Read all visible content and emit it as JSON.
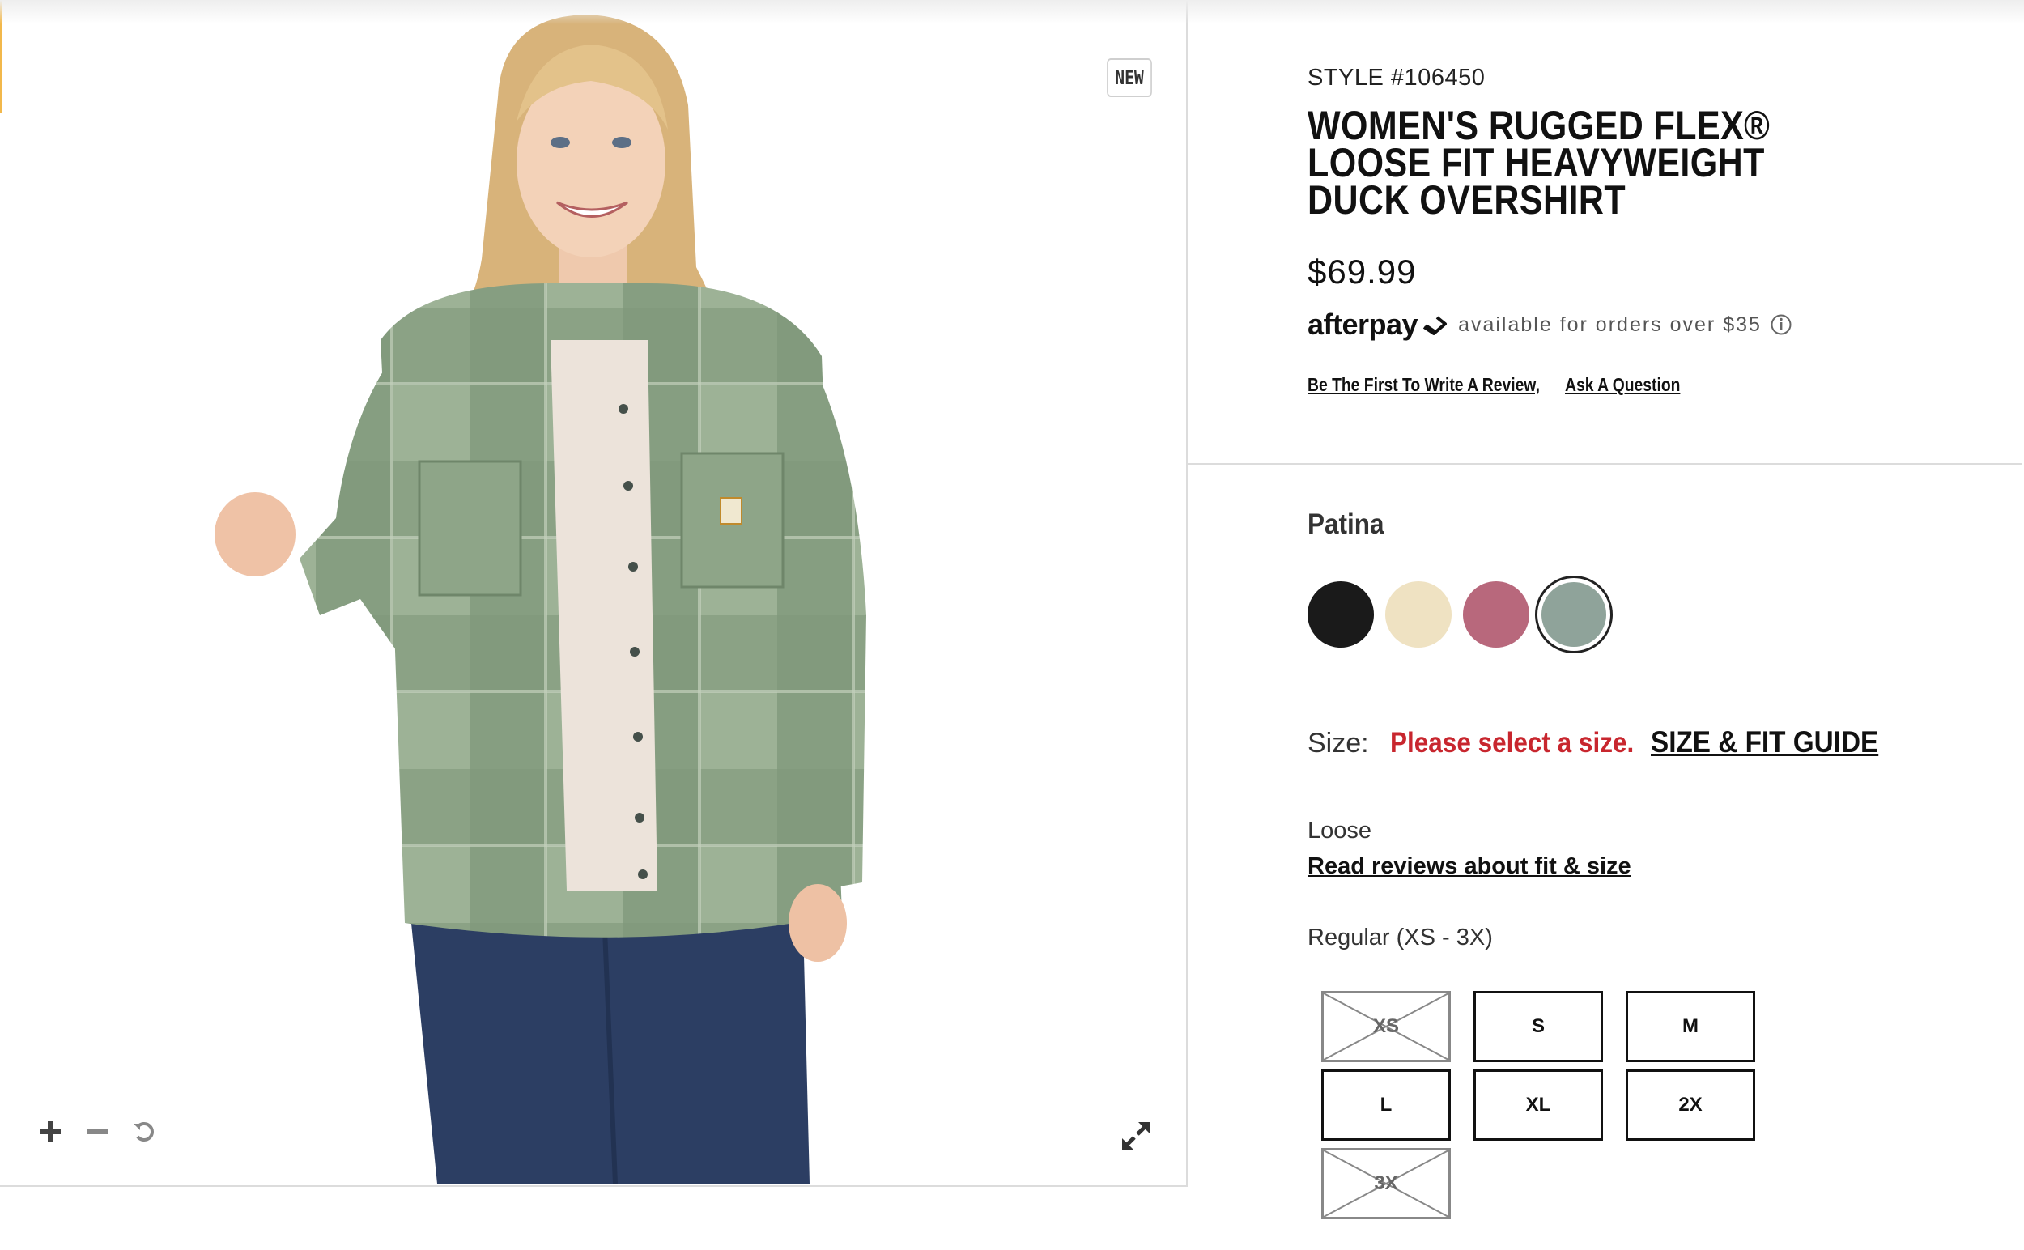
{
  "gallery": {
    "badge": "NEW",
    "image_alt": "Woman wearing a green plaid overshirt over a light t-shirt and jeans",
    "controls": [
      "zoom-in",
      "zoom-out",
      "reset"
    ]
  },
  "product": {
    "style_number": "STYLE #106450",
    "title": "WOMEN'S RUGGED FLEX® LOOSE FIT HEAVYWEIGHT DUCK OVERSHIRT",
    "price": "$69.99",
    "afterpay": {
      "logo": "afterpay",
      "text": "available for orders over $35"
    },
    "links": {
      "review": "Be The First To Write A Review,",
      "question": "Ask A Question"
    }
  },
  "color": {
    "selected_name": "Patina",
    "swatches": [
      {
        "name": "black",
        "hex": "#1a1a1a",
        "selected": false
      },
      {
        "name": "cream",
        "hex": "#efe2c2",
        "selected": false
      },
      {
        "name": "rose",
        "hex": "#b8687c",
        "selected": false
      },
      {
        "name": "patina",
        "hex": "#8fa39a",
        "selected": true
      }
    ]
  },
  "size": {
    "label": "Size:",
    "error": "Please select a size.",
    "guide_link": "SIZE & FIT GUIDE",
    "fit_label": "Loose",
    "fit_link": "Read reviews about fit & size",
    "range_label": "Regular (XS - 3X)",
    "options": [
      {
        "label": "XS",
        "available": false
      },
      {
        "label": "S",
        "available": true
      },
      {
        "label": "M",
        "available": true
      },
      {
        "label": "L",
        "available": true
      },
      {
        "label": "XL",
        "available": true
      },
      {
        "label": "2X",
        "available": true
      },
      {
        "label": "3X",
        "available": false
      }
    ]
  }
}
